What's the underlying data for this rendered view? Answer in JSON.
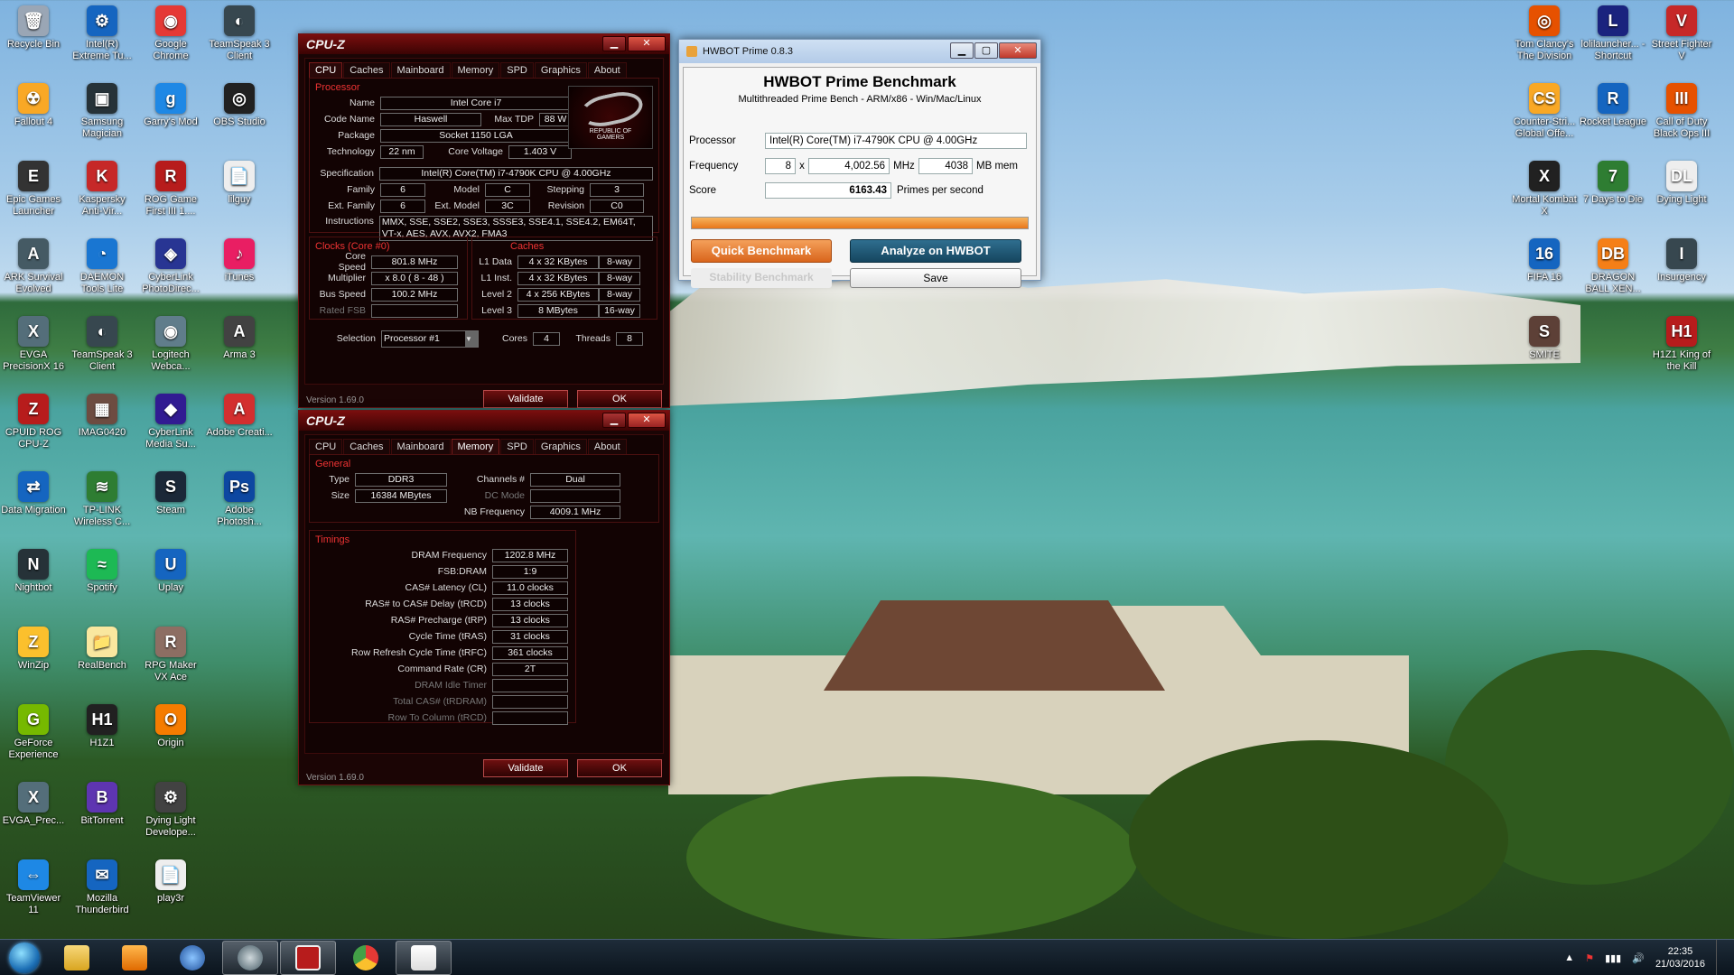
{
  "desktop": {
    "icons_left": [
      {
        "label": "Recycle Bin",
        "color": "#9aa6b5",
        "glyph": "🗑"
      },
      {
        "label": "Intel(R) Extreme Tu...",
        "color": "#1565c0",
        "glyph": "⚙"
      },
      {
        "label": "Google Chrome",
        "color": "#e53935",
        "glyph": "◉"
      },
      {
        "label": "TeamSpeak 3 Client",
        "color": "#37474f",
        "glyph": "◐"
      },
      {
        "label": "Fallout 4",
        "color": "#f9a825",
        "glyph": "☢"
      },
      {
        "label": "Samsung Magician",
        "color": "#263238",
        "glyph": "▣"
      },
      {
        "label": "Garry's Mod",
        "color": "#1e88e5",
        "glyph": "g"
      },
      {
        "label": "OBS Studio",
        "color": "#212121",
        "glyph": "◎"
      },
      {
        "label": "Epic Games Launcher",
        "color": "#333",
        "glyph": "E"
      },
      {
        "label": "Kaspersky Anti-Vir...",
        "color": "#c62828",
        "glyph": "K"
      },
      {
        "label": "ROG Game First III 1....",
        "color": "#b71c1c",
        "glyph": "R"
      },
      {
        "label": "lilguy",
        "color": "#eeeeee",
        "glyph": "📄"
      },
      {
        "label": "ARK Survival Evolved",
        "color": "#455a64",
        "glyph": "A"
      },
      {
        "label": "DAEMON Tools Lite",
        "color": "#1976d2",
        "glyph": "◔"
      },
      {
        "label": "CyberLink PhotoDirec...",
        "color": "#283593",
        "glyph": "◈"
      },
      {
        "label": "iTunes",
        "color": "#e91e63",
        "glyph": "♪"
      },
      {
        "label": "EVGA PrecisionX 16",
        "color": "#546e7a",
        "glyph": "X"
      },
      {
        "label": "TeamSpeak 3 Client",
        "color": "#37474f",
        "glyph": "◐"
      },
      {
        "label": "Logitech Webca...",
        "color": "#607d8b",
        "glyph": "◉"
      },
      {
        "label": "Arma 3",
        "color": "#424242",
        "glyph": "A"
      },
      {
        "label": "CPUID ROG CPU-Z",
        "color": "#b71c1c",
        "glyph": "Z"
      },
      {
        "label": "IMAG0420",
        "color": "#6d4c41",
        "glyph": "▦"
      },
      {
        "label": "CyberLink Media Su...",
        "color": "#311b92",
        "glyph": "◆"
      },
      {
        "label": "Adobe Creati...",
        "color": "#d32f2f",
        "glyph": "A"
      },
      {
        "label": "Data Migration",
        "color": "#1565c0",
        "glyph": "⇄"
      },
      {
        "label": "TP-LINK Wireless C...",
        "color": "#2e7d32",
        "glyph": "≋"
      },
      {
        "label": "Steam",
        "color": "#1b2838",
        "glyph": "S"
      },
      {
        "label": "Adobe Photosh...",
        "color": "#0d47a1",
        "glyph": "Ps"
      },
      {
        "label": "Nightbot",
        "color": "#263238",
        "glyph": "N"
      },
      {
        "label": "Spotify",
        "color": "#1db954",
        "glyph": "≈"
      },
      {
        "label": "Uplay",
        "color": "#1565c0",
        "glyph": "U"
      },
      {
        "label": "",
        "color": "transparent",
        "glyph": ""
      },
      {
        "label": "WinZip",
        "color": "#fbc02d",
        "glyph": "Z"
      },
      {
        "label": "RealBench",
        "color": "#f9e79f",
        "glyph": "📁"
      },
      {
        "label": "RPG Maker VX Ace",
        "color": "#8d6e63",
        "glyph": "R"
      },
      {
        "label": "",
        "color": "transparent",
        "glyph": ""
      },
      {
        "label": "GeForce Experience",
        "color": "#76b900",
        "glyph": "G"
      },
      {
        "label": "H1Z1",
        "color": "#212121",
        "glyph": "H1"
      },
      {
        "label": "Origin",
        "color": "#f57c00",
        "glyph": "O"
      },
      {
        "label": "",
        "color": "transparent",
        "glyph": ""
      },
      {
        "label": "EVGA_Prec...",
        "color": "#546e7a",
        "glyph": "X"
      },
      {
        "label": "BitTorrent",
        "color": "#5e35b1",
        "glyph": "B"
      },
      {
        "label": "Dying Light Develope...",
        "color": "#424242",
        "glyph": "⚙"
      },
      {
        "label": "",
        "color": "transparent",
        "glyph": ""
      },
      {
        "label": "TeamViewer 11",
        "color": "#1e88e5",
        "glyph": "⇔"
      },
      {
        "label": "Mozilla Thunderbird",
        "color": "#1565c0",
        "glyph": "✉"
      },
      {
        "label": "play3r",
        "color": "#eeeeee",
        "glyph": "📄"
      }
    ],
    "icons_right": [
      {
        "label": "Tom Clancy's The Division",
        "color": "#e65100",
        "glyph": "◎"
      },
      {
        "label": "lolilauncher... - Shortcut",
        "color": "#1a237e",
        "glyph": "L"
      },
      {
        "label": "Street Fighter V",
        "color": "#c62828",
        "glyph": "V"
      },
      {
        "label": "Counter-Stri... Global Offe...",
        "color": "#f9a825",
        "glyph": "CS"
      },
      {
        "label": "Rocket League",
        "color": "#1565c0",
        "glyph": "R"
      },
      {
        "label": "Call of Duty Black Ops III",
        "color": "#e65100",
        "glyph": "III"
      },
      {
        "label": "Mortal Kombat X",
        "color": "#212121",
        "glyph": "X"
      },
      {
        "label": "7 Days to Die",
        "color": "#2e7d32",
        "glyph": "7"
      },
      {
        "label": "Dying Light",
        "color": "#eeeeee",
        "glyph": "DL"
      },
      {
        "label": "FIFA 16",
        "color": "#1565c0",
        "glyph": "16"
      },
      {
        "label": "DRAGON BALL XEN...",
        "color": "#f57f17",
        "glyph": "DB"
      },
      {
        "label": "Insurgency",
        "color": "#37474f",
        "glyph": "I"
      },
      {
        "label": "SMITE",
        "color": "#5d4037",
        "glyph": "S"
      },
      {
        "label": "",
        "color": "transparent",
        "glyph": ""
      },
      {
        "label": "H1Z1 King of the Kill",
        "color": "#b71c1c",
        "glyph": "H1"
      }
    ]
  },
  "cpuz_cpu": {
    "title": "CPU-Z",
    "tabs": [
      "CPU",
      "Caches",
      "Mainboard",
      "Memory",
      "SPD",
      "Graphics",
      "About"
    ],
    "processor_legend": "Processor",
    "name_label": "Name",
    "name": "Intel Core i7",
    "codename_label": "Code Name",
    "codename": "Haswell",
    "maxtdp_label": "Max TDP",
    "maxtdp": "88 W",
    "package_label": "Package",
    "package": "Socket 1150 LGA",
    "technology_label": "Technology",
    "technology": "22 nm",
    "voltage_label": "Core Voltage",
    "voltage": "1.403 V",
    "spec_label": "Specification",
    "spec": "Intel(R) Core(TM) i7-4790K CPU @ 4.00GHz",
    "family_label": "Family",
    "family": "6",
    "model_label": "Model",
    "model": "C",
    "stepping_label": "Stepping",
    "stepping": "3",
    "extfamily_label": "Ext. Family",
    "extfamily": "6",
    "extmodel_label": "Ext. Model",
    "extmodel": "3C",
    "revision_label": "Revision",
    "revision": "C0",
    "instr_label": "Instructions",
    "instr1": "MMX, SSE, SSE2, SSE3, SSSE3, SSE4.1, SSE4.2, EM64T,",
    "instr2": "VT-x, AES, AVX, AVX2, FMA3",
    "rog1": "REPUBLIC OF",
    "rog2": "GAMERS",
    "clocks_legend": "Clocks (Core #0)",
    "corespeed_label": "Core Speed",
    "corespeed": "801.8 MHz",
    "mult_label": "Multiplier",
    "mult": "x 8.0 ( 8 - 48 )",
    "bus_label": "Bus Speed",
    "bus": "100.2 MHz",
    "fsb_label": "Rated FSB",
    "fsb": "",
    "caches_legend": "Caches",
    "l1d_label": "L1 Data",
    "l1d": "4 x 32 KBytes",
    "l1d_way": "8-way",
    "l1i_label": "L1 Inst.",
    "l1i": "4 x 32 KBytes",
    "l1i_way": "8-way",
    "l2_label": "Level 2",
    "l2": "4 x 256 KBytes",
    "l2_way": "8-way",
    "l3_label": "Level 3",
    "l3": "8 MBytes",
    "l3_way": "16-way",
    "selection_label": "Selection",
    "selection": "Processor #1",
    "cores_label": "Cores",
    "cores": "4",
    "threads_label": "Threads",
    "threads": "8",
    "validate": "Validate",
    "ok": "OK",
    "version": "Version 1.69.0"
  },
  "cpuz_mem": {
    "title": "CPU-Z",
    "tabs": [
      "CPU",
      "Caches",
      "Mainboard",
      "Memory",
      "SPD",
      "Graphics",
      "About"
    ],
    "general_legend": "General",
    "type_label": "Type",
    "type": "DDR3",
    "size_label": "Size",
    "size": "16384 MBytes",
    "channels_label": "Channels #",
    "channels": "Dual",
    "dcmode_label": "DC Mode",
    "dcmode": "",
    "nbfreq_label": "NB Frequency",
    "nbfreq": "4009.1 MHz",
    "timings_legend": "Timings",
    "timings": [
      {
        "label": "DRAM Frequency",
        "value": "1202.8 MHz",
        "dim": false
      },
      {
        "label": "FSB:DRAM",
        "value": "1:9",
        "dim": false
      },
      {
        "label": "CAS# Latency (CL)",
        "value": "11.0 clocks",
        "dim": false
      },
      {
        "label": "RAS# to CAS# Delay (tRCD)",
        "value": "13 clocks",
        "dim": false
      },
      {
        "label": "RAS# Precharge (tRP)",
        "value": "13 clocks",
        "dim": false
      },
      {
        "label": "Cycle Time (tRAS)",
        "value": "31 clocks",
        "dim": false
      },
      {
        "label": "Row Refresh Cycle Time (tRFC)",
        "value": "361 clocks",
        "dim": false
      },
      {
        "label": "Command Rate (CR)",
        "value": "2T",
        "dim": false
      },
      {
        "label": "DRAM Idle Timer",
        "value": "",
        "dim": true
      },
      {
        "label": "Total CAS# (tRDRAM)",
        "value": "",
        "dim": true
      },
      {
        "label": "Row To Column (tRCD)",
        "value": "",
        "dim": true
      }
    ],
    "validate": "Validate",
    "ok": "OK",
    "version": "Version 1.69.0"
  },
  "hwbot": {
    "title": "HWBOT Prime 0.8.3",
    "heading": "HWBOT Prime Benchmark",
    "subheading": "Multithreaded Prime Bench - ARM/x86 - Win/Mac/Linux",
    "processor_label": "Processor",
    "processor": "Intel(R) Core(TM) i7-4790K CPU @ 4.00GHz",
    "frequency_label": "Frequency",
    "threads": "8",
    "x": "x",
    "mhz_value": "4,002.56",
    "mhz": "MHz",
    "mem_value": "4038",
    "mem_unit": "MB mem",
    "score_label": "Score",
    "score": "6163.43",
    "score_unit": "Primes per second",
    "progress": 1.0,
    "quick": "Quick Benchmark",
    "analyze": "Analyze on HWBOT",
    "stability": "Stability Benchmark",
    "save": "Save"
  },
  "taskbar": {
    "time": "22:35",
    "date": "21/03/2016"
  }
}
